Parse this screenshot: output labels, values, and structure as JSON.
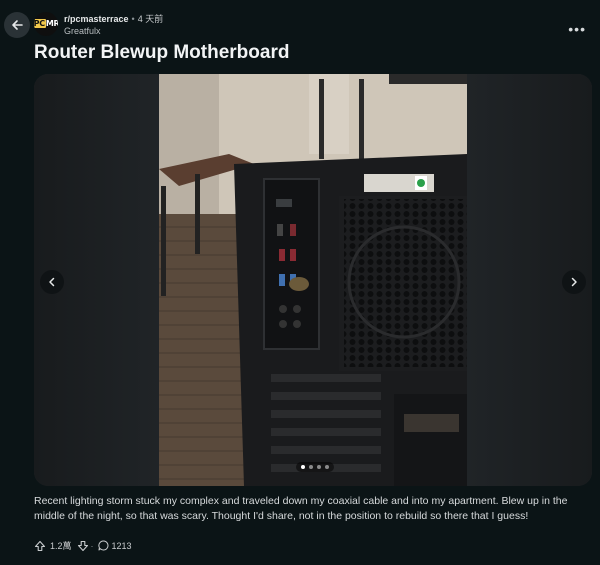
{
  "header": {
    "subreddit": "r/pcmasterrace",
    "subreddit_logo_text": "PCMR",
    "time_ago": "4 天前",
    "author": "Greatfulx"
  },
  "post": {
    "title": "Router Blewup Motherboard",
    "body": "Recent lighting storm stuck my complex and traveled down my coaxial cable and into my apartment. Blew up in the middle of the night, so that was scary. Thought I'd share, not in the position to rebuild so there that I guess!"
  },
  "gallery": {
    "image_count": 4,
    "active_index": 0
  },
  "actions": {
    "upvotes": "1.2萬",
    "comments": "1213"
  },
  "icons": {
    "back": "arrow-left-icon",
    "more": "ellipsis-icon",
    "prev": "chevron-left-icon",
    "next": "chevron-right-icon",
    "upvote": "upvote-arrow-icon",
    "downvote": "downvote-arrow-icon",
    "comment": "comment-bubble-icon"
  },
  "colors": {
    "background": "#0b1416",
    "text": "#f2f4f5",
    "muted": "#c8cbcd"
  }
}
